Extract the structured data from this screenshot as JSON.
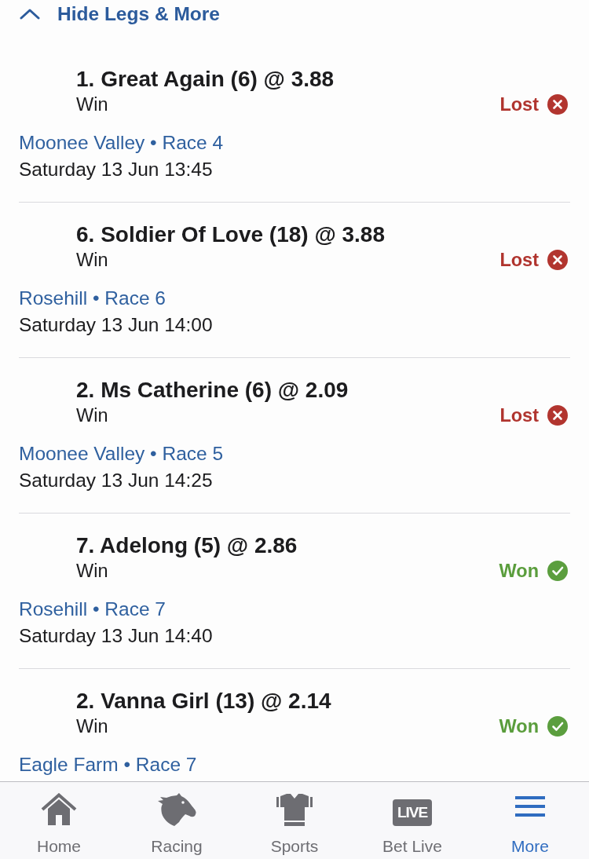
{
  "toggle": {
    "label": "Hide Legs & More",
    "expanded": true
  },
  "legs": [
    {
      "selection": "1. Great Again (6) @ 3.88",
      "bet_type": "Win",
      "kind": "lost",
      "result_label": "Lost",
      "venue": "Moonee Valley • Race 4",
      "start_time": "Saturday 13 Jun 13:45"
    },
    {
      "selection": "6. Soldier Of Love (18) @ 3.88",
      "bet_type": "Win",
      "kind": "lost",
      "result_label": "Lost",
      "venue": "Rosehill • Race 6",
      "start_time": "Saturday 13 Jun 14:00"
    },
    {
      "selection": "2. Ms Catherine (6) @ 2.09",
      "bet_type": "Win",
      "kind": "lost",
      "result_label": "Lost",
      "venue": "Moonee Valley • Race 5",
      "start_time": "Saturday 13 Jun 14:25"
    },
    {
      "selection": "7. Adelong (5) @ 2.86",
      "bet_type": "Win",
      "kind": "won",
      "result_label": "Won",
      "venue": "Rosehill • Race 7",
      "start_time": "Saturday 13 Jun 14:40"
    },
    {
      "selection": "2. Vanna Girl (13) @ 2.14",
      "bet_type": "Win",
      "kind": "won",
      "result_label": "Won",
      "venue": "Eagle Farm • Race 7"
    }
  ],
  "tab_bar": [
    {
      "label": "Home",
      "selected": false
    },
    {
      "label": "Racing",
      "selected": false
    },
    {
      "label": "Sports",
      "selected": false
    },
    {
      "label": "Bet Live",
      "badge": "LIVE",
      "selected": false
    },
    {
      "label": "More",
      "selected": true
    }
  ]
}
